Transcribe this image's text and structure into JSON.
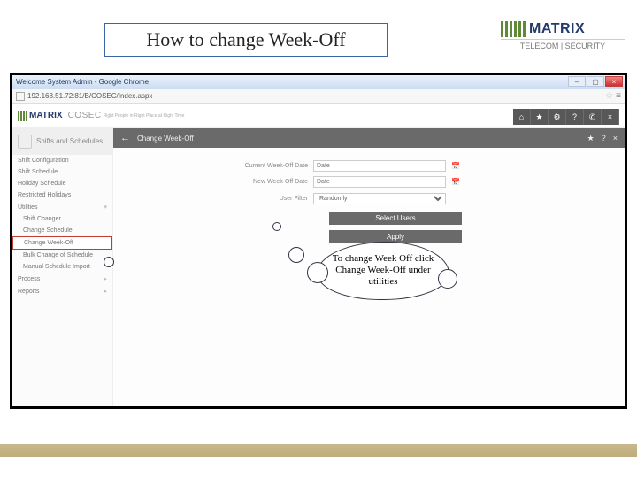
{
  "slide": {
    "title": "How to change Week-Off"
  },
  "brand": {
    "name": "MATRIX",
    "sub": "TELECOM | SECURITY"
  },
  "chrome": {
    "tab_title": "Welcome System Admin - Google Chrome",
    "url": "192.168.51.72:81/B/COSEC/Index.aspx",
    "product": "COSEC",
    "tagline": "Right People in Right Place at Right Time"
  },
  "toolbar_icons": {
    "home": "⌂",
    "fav": "★",
    "settings": "⚙",
    "help": "?",
    "phone": "✆",
    "close": "×"
  },
  "sidebar": {
    "section_title": "Shifts and Schedules",
    "items": [
      "Shift Configuration",
      "Shift Schedule",
      "Holiday Schedule",
      "Restricted Holidays",
      "Utilities"
    ],
    "utilities": [
      "Shift Changer",
      "Change Schedule",
      "Change Week-Off",
      "Bulk Change of Schedule",
      "Manual Schedule Import"
    ],
    "tail": [
      "Process",
      "Reports"
    ]
  },
  "main": {
    "header": "Change Week-Off",
    "back": "←",
    "icons": {
      "star": "★",
      "help": "?",
      "close": "×"
    },
    "fields": {
      "current_label": "Current Week-Off Date",
      "current_value": "Date",
      "new_label": "New Week-Off Date",
      "new_value": "Date",
      "filter_label": "User Filter",
      "filter_value": "Randomly"
    },
    "buttons": {
      "select": "Select Users",
      "apply": "Apply"
    }
  },
  "callout": {
    "text": "To change Week Off click Change Week-Off under utilities"
  }
}
